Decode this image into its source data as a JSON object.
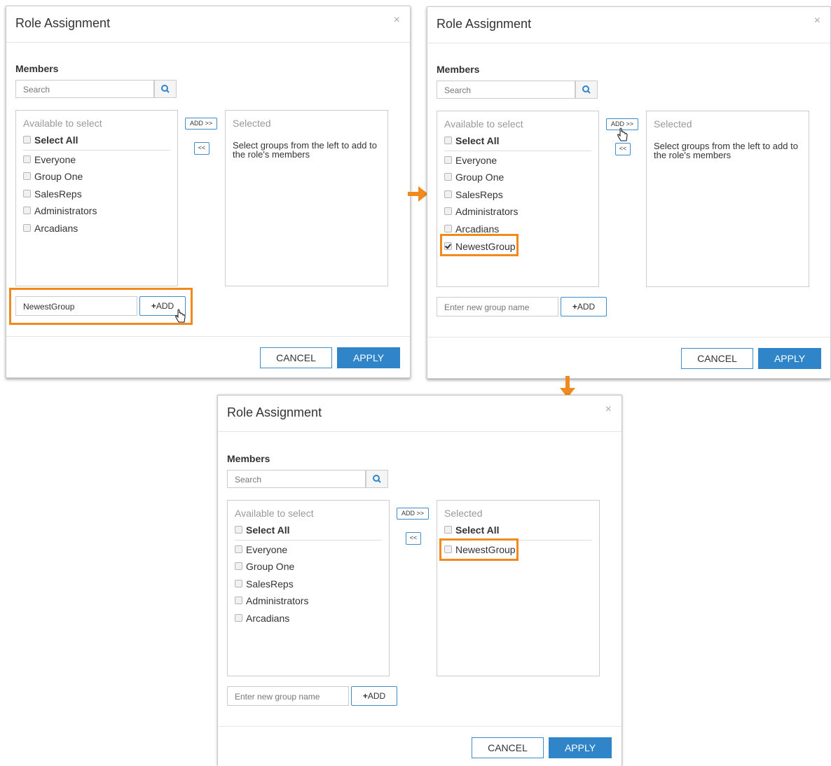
{
  "colors": {
    "highlight": "#f08a1c",
    "primary": "#2f85c8",
    "border": "#cccccc"
  },
  "icons": {
    "search": "search-icon",
    "close": "close-icon",
    "cursor": "hand-pointer-icon",
    "arrow": "arrow-icon",
    "plus": "plus-icon"
  },
  "panels": [
    {
      "title": "Role Assignment",
      "close": "×",
      "members_label": "Members",
      "search_placeholder": "Search",
      "available_header": "Available to select",
      "select_all": "Select All",
      "available_items": [
        "Everyone",
        "Group One",
        "SalesReps",
        "Administrators",
        "Arcadians"
      ],
      "selected_header": "Selected",
      "selected_hint": "Select groups from the left to add to the role's members",
      "add_selected": "ADD >>",
      "remove_selected": "<<",
      "new_group_value": "NewestGroup",
      "add_group": "ADD",
      "cancel": "CANCEL",
      "apply": "APPLY"
    },
    {
      "title": "Role Assignment",
      "close": "×",
      "members_label": "Members",
      "search_placeholder": "Search",
      "available_header": "Available to select",
      "select_all": "Select All",
      "available_items": [
        "Everyone",
        "Group One",
        "SalesReps",
        "Administrators",
        "Arcadians"
      ],
      "new_item_checked": "NewestGroup",
      "selected_header": "Selected",
      "selected_hint": "Select groups from the left to add to the role's members",
      "add_selected": "ADD >>",
      "remove_selected": "<<",
      "new_group_placeholder": "Enter new group name",
      "add_group": "ADD",
      "cancel": "CANCEL",
      "apply": "APPLY"
    },
    {
      "title": "Role Assignment",
      "close": "×",
      "members_label": "Members",
      "search_placeholder": "Search",
      "available_header": "Available to select",
      "select_all": "Select All",
      "available_items": [
        "Everyone",
        "Group One",
        "SalesReps",
        "Administrators",
        "Arcadians"
      ],
      "selected_header": "Selected",
      "selected_select_all": "Select All",
      "selected_item": "NewestGroup",
      "add_selected": "ADD >>",
      "remove_selected": "<<",
      "new_group_placeholder": "Enter new group name",
      "add_group": "ADD",
      "cancel": "CANCEL",
      "apply": "APPLY"
    }
  ]
}
